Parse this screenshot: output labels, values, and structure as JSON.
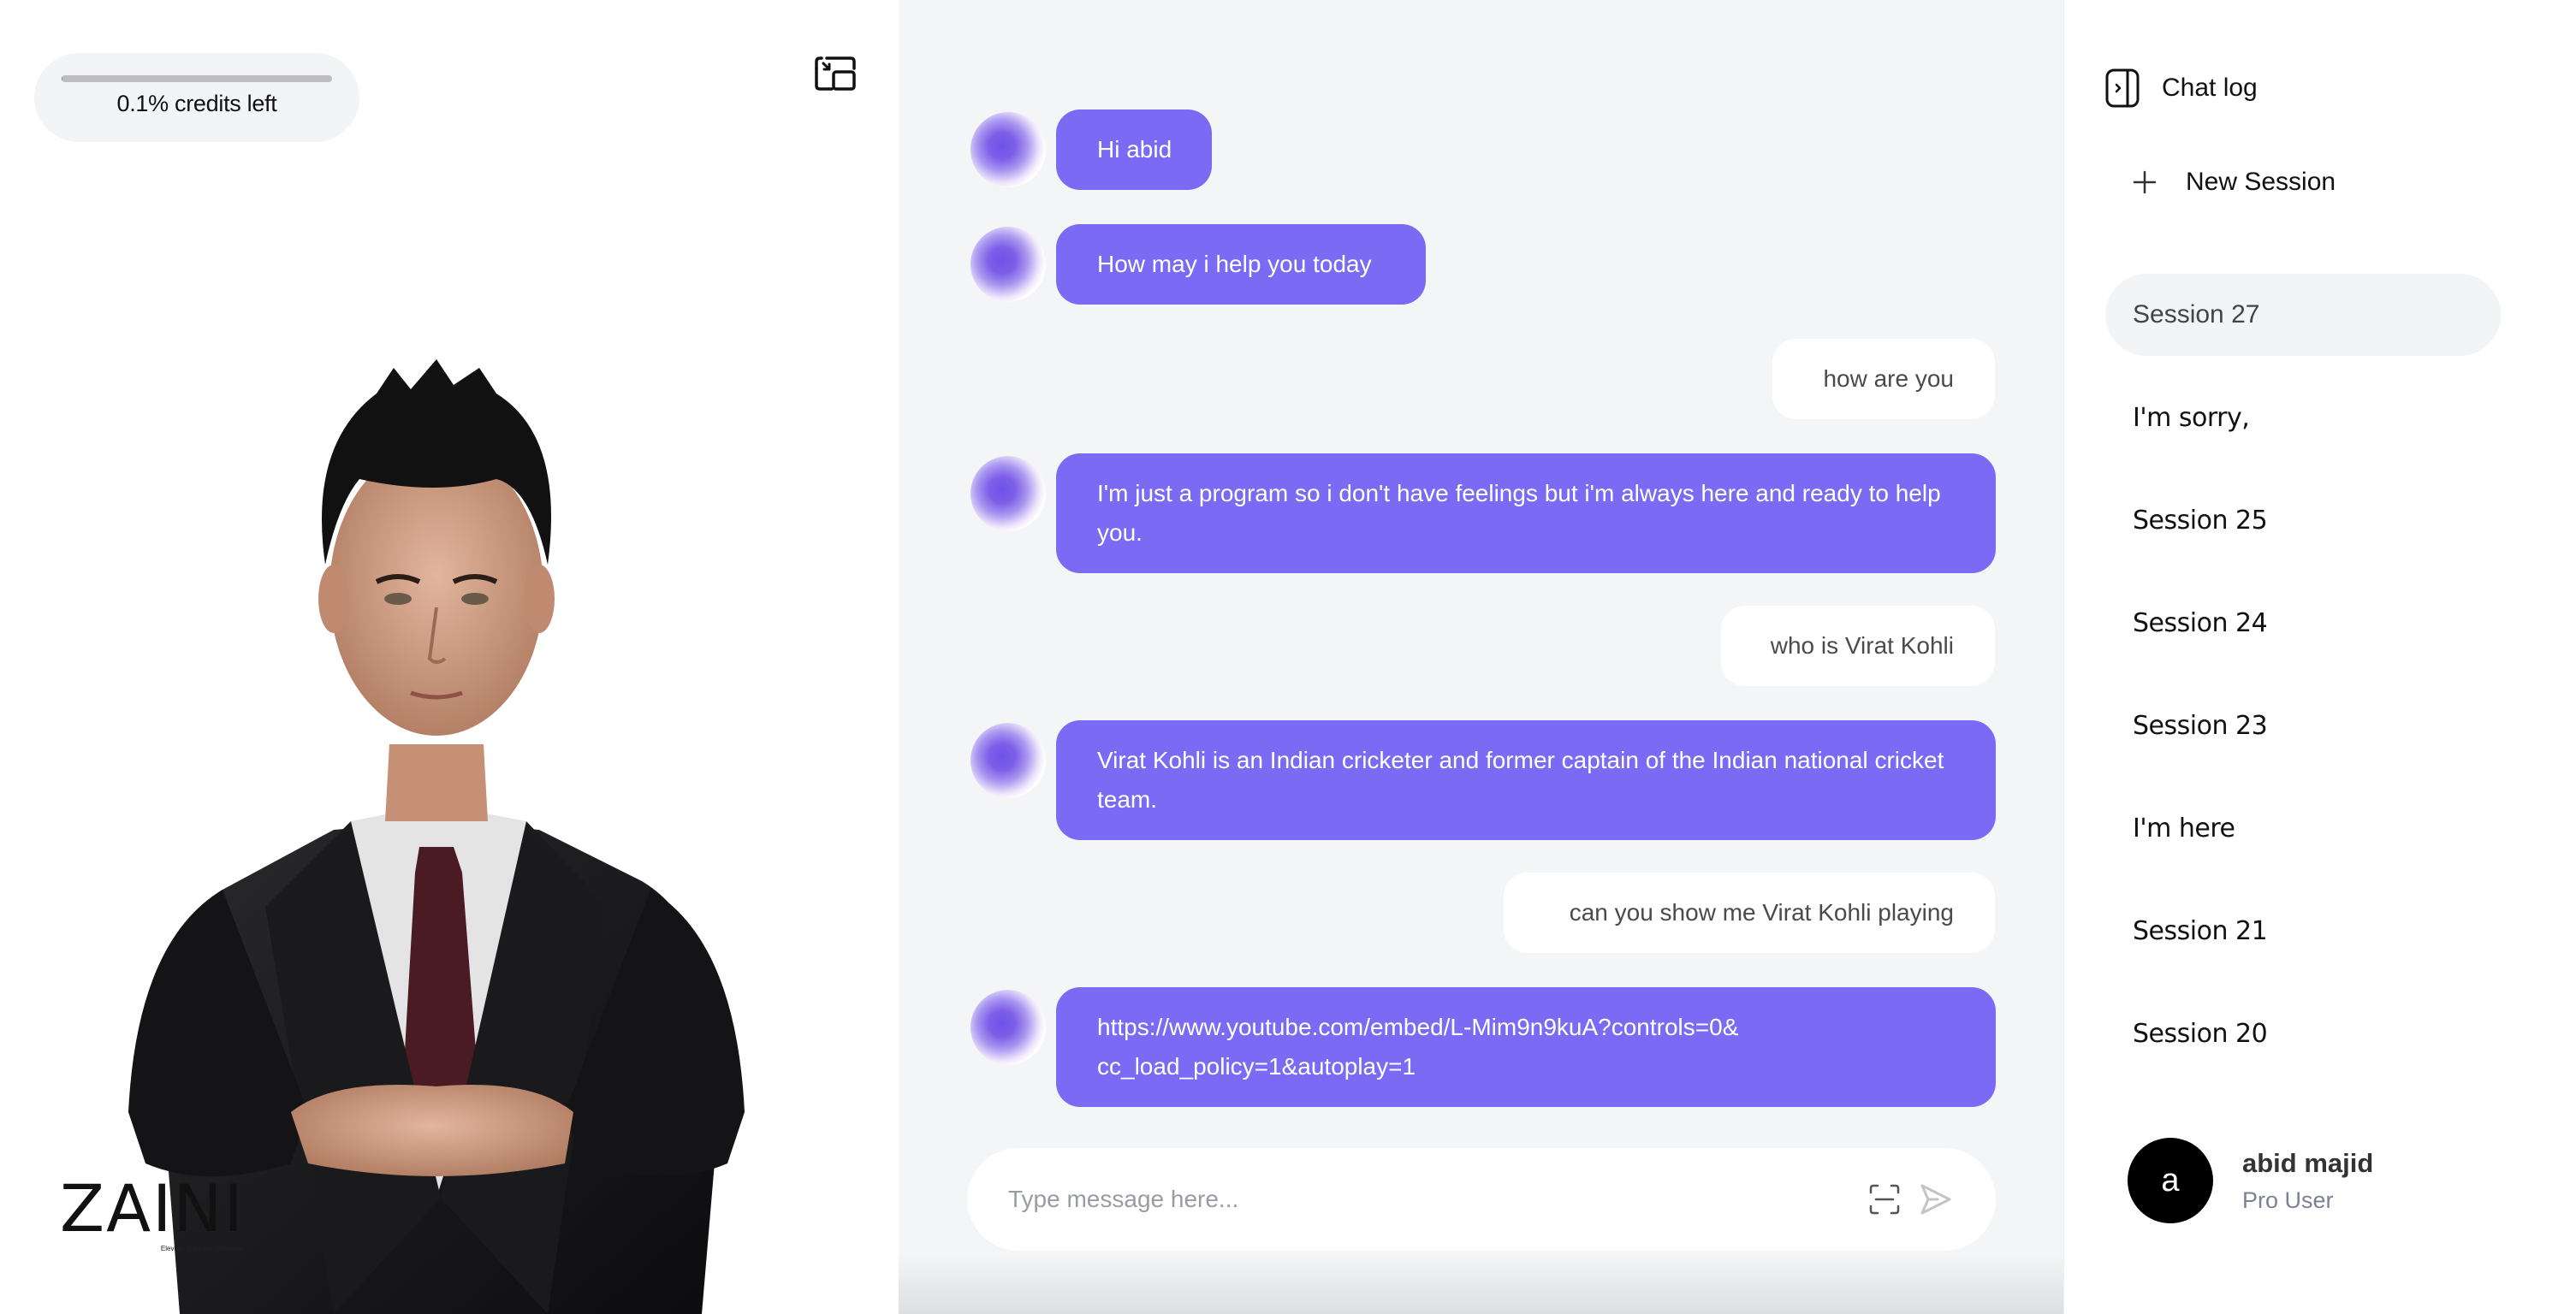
{
  "credits": {
    "label": "0.1% credits left",
    "percent_left": 0.1
  },
  "left_panel": {
    "pip_icon": "picture-in-picture-icon",
    "logo": {
      "word": "ZAINI",
      "tagline": "Elevate. Educate. Innovate."
    }
  },
  "chat": {
    "colors": {
      "bot_bubble": "#7a6af4",
      "user_bubble": "#ffffff",
      "background": "#f4f5f7"
    },
    "messages": [
      {
        "role": "bot",
        "text": "Hi abid"
      },
      {
        "role": "bot",
        "text": "How may i help you today"
      },
      {
        "role": "user",
        "text": "how are you"
      },
      {
        "role": "bot",
        "text": "I'm just a program so i don't have feelings but i'm always here and ready to help you."
      },
      {
        "role": "user",
        "text": "who is Virat Kohli"
      },
      {
        "role": "bot",
        "text": "Virat Kohli is an Indian cricketer and former captain of the Indian national cricket team."
      },
      {
        "role": "user",
        "text": "can you show me Virat Kohli playing"
      },
      {
        "role": "bot",
        "text": "https://www.youtube.com/embed/L-Mim9n9kuA?controls=0&cc_load_policy=1&autoplay=1"
      }
    ],
    "input": {
      "value": "",
      "placeholder": "Type message here..."
    }
  },
  "sidebar": {
    "title": "Chat log",
    "new_session_label": "New Session",
    "sessions": [
      {
        "label": "Session 27",
        "active": true
      },
      {
        "label": "I'm sorry,",
        "active": false
      },
      {
        "label": "Session 25",
        "active": false
      },
      {
        "label": "Session 24",
        "active": false
      },
      {
        "label": "Session 23",
        "active": false
      },
      {
        "label": "I'm here",
        "active": false
      },
      {
        "label": "Session 21",
        "active": false
      },
      {
        "label": "Session 20",
        "active": false
      }
    ],
    "user": {
      "initial": "a",
      "name": "abid majid",
      "role": "Pro User"
    }
  }
}
